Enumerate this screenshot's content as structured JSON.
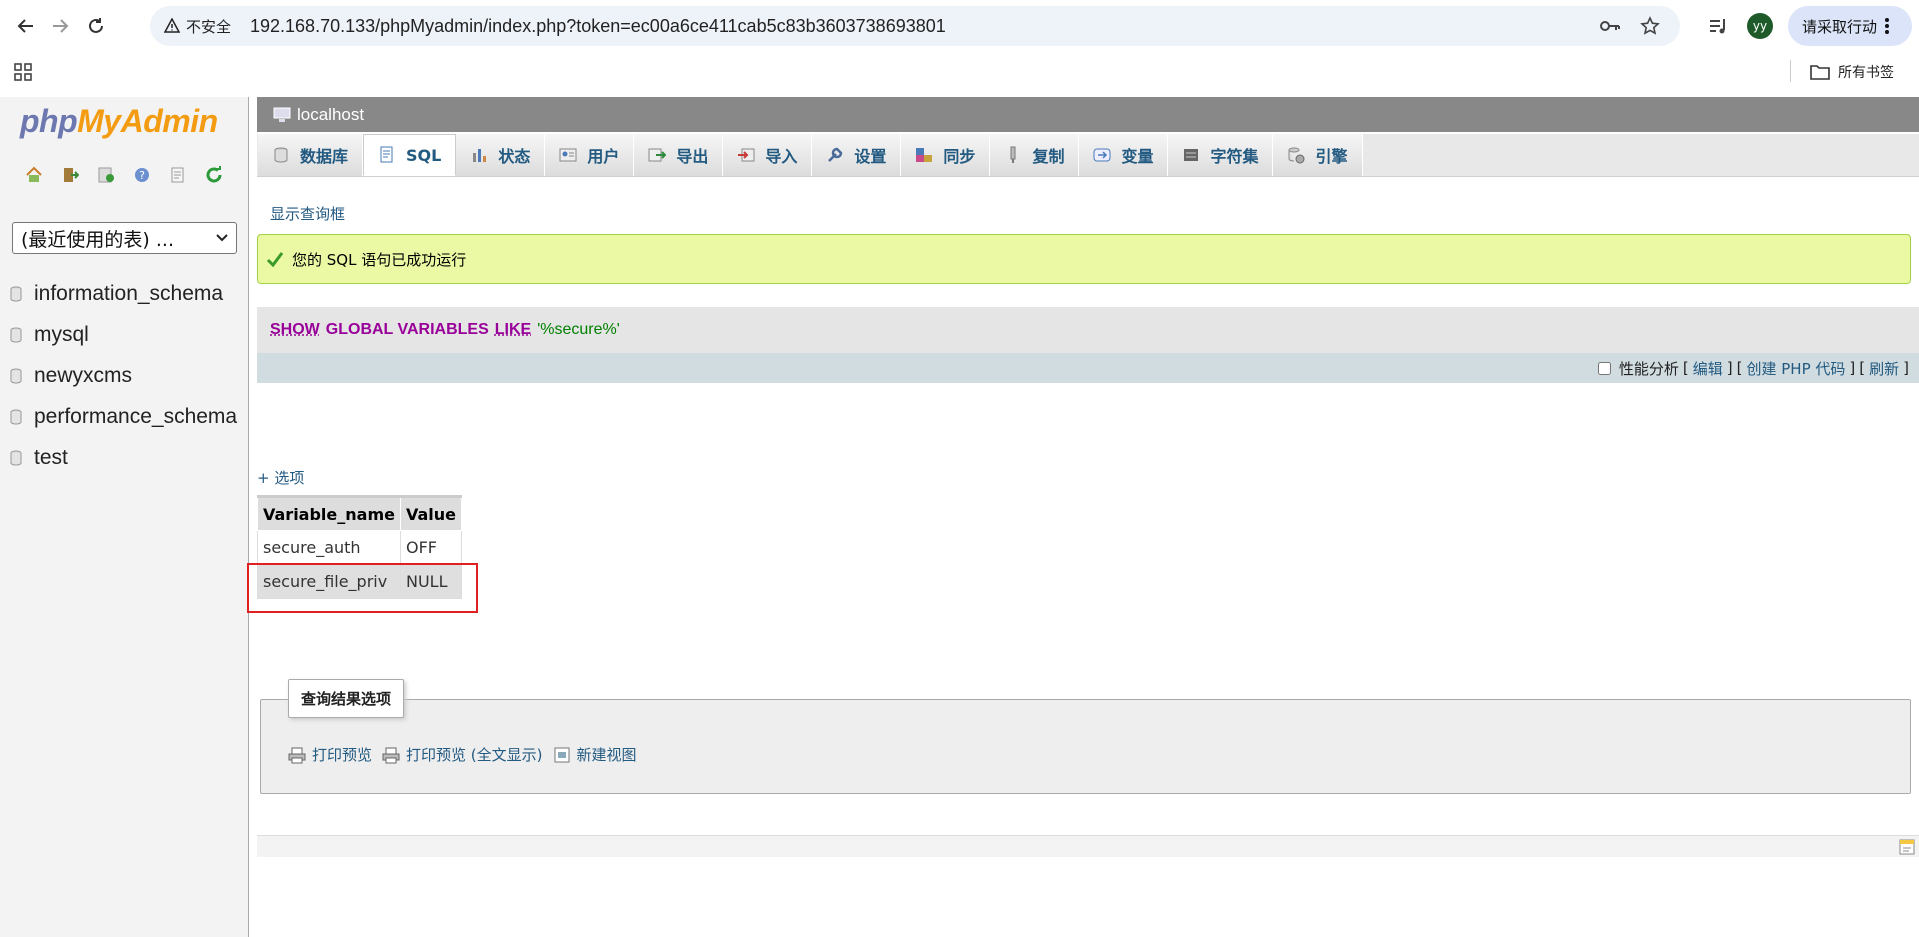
{
  "browser": {
    "security_label": "不安全",
    "url": "192.168.70.133/phpMyadmin/index.php?token=ec00a6ce411cab5c83b3603738693801",
    "avatar_initials": "yy",
    "action_button": "请采取行动",
    "bookmarks_folder": "所有书签"
  },
  "leftnav": {
    "logo_php": "php",
    "logo_myadmin": "MyAdmin",
    "recent_select": "(最近使用的表) ...",
    "databases": [
      "information_schema",
      "mysql",
      "newyxcms",
      "performance_schema",
      "test"
    ]
  },
  "serverbar": {
    "label": "localhost"
  },
  "tabs": [
    {
      "label": "数据库",
      "icon": "database-icon"
    },
    {
      "label": "SQL",
      "icon": "sql-icon"
    },
    {
      "label": "状态",
      "icon": "status-icon"
    },
    {
      "label": "用户",
      "icon": "users-icon"
    },
    {
      "label": "导出",
      "icon": "export-icon"
    },
    {
      "label": "导入",
      "icon": "import-icon"
    },
    {
      "label": "设置",
      "icon": "settings-icon"
    },
    {
      "label": "同步",
      "icon": "sync-icon"
    },
    {
      "label": "复制",
      "icon": "replication-icon"
    },
    {
      "label": "变量",
      "icon": "variables-icon"
    },
    {
      "label": "字符集",
      "icon": "charset-icon"
    },
    {
      "label": "引擎",
      "icon": "engine-icon"
    }
  ],
  "active_tab": "SQL",
  "main": {
    "show_query_link": "显示查询框",
    "success_message": "您的 SQL 语句已成功运行",
    "sql": {
      "kw_show": "SHOW",
      "kw_global_variables": "GLOBAL VARIABLES",
      "kw_like": "LIKE",
      "string": "'%secure%'"
    },
    "sqlbar": {
      "profiling": "性能分析",
      "edit": "编辑",
      "create_php": "创建 PHP 代码",
      "refresh": "刷新",
      "open_bracket": "[",
      "close_bracket": "]"
    },
    "options_link": "+ 选项",
    "result_table": {
      "headers": [
        "Variable_name",
        "Value"
      ],
      "rows": [
        [
          "secure_auth",
          "OFF"
        ],
        [
          "secure_file_priv",
          "NULL"
        ]
      ]
    },
    "result_options": {
      "legend": "查询结果选项",
      "print_view": "打印预览",
      "print_view_full": "打印预览 (全文显示)",
      "create_view": "新建视图"
    }
  },
  "colors": {
    "link": "#235a81",
    "sql_keyword": "#990099",
    "sql_string": "#008000",
    "success_bg": "#ebf8a4",
    "highlight": "#e02020"
  }
}
